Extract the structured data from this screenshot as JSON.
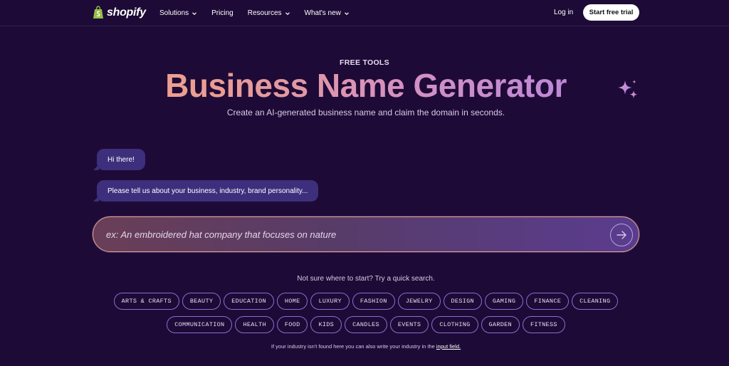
{
  "nav": {
    "logo_text": "shopify",
    "links": [
      {
        "label": "Solutions",
        "dropdown": true
      },
      {
        "label": "Pricing",
        "dropdown": false
      },
      {
        "label": "Resources",
        "dropdown": true
      },
      {
        "label": "What's new",
        "dropdown": true
      }
    ],
    "login_label": "Log in",
    "cta_label": "Start free trial"
  },
  "hero": {
    "eyebrow": "FREE TOOLS",
    "title": "Business Name Generator",
    "subtitle": "Create an AI-generated business name and claim the domain in seconds."
  },
  "chat": {
    "messages": [
      "Hi there!",
      "Please tell us about your business, industry, brand personality..."
    ]
  },
  "prompt": {
    "placeholder": "ex: An embroidered hat company that focuses on nature",
    "value": ""
  },
  "quick_search": {
    "hint": "Not sure where to start? Try a quick search.",
    "row1": [
      "ARTS & CRAFTS",
      "BEAUTY",
      "EDUCATION",
      "HOME",
      "LUXURY",
      "FASHION",
      "JEWELRY",
      "DESIGN",
      "GAMING",
      "FINANCE",
      "CLEANING"
    ],
    "row2": [
      "COMMUNICATION",
      "HEALTH",
      "FOOD",
      "KIDS",
      "CANDLES",
      "EVENTS",
      "CLOTHING",
      "GARDEN",
      "FITNESS"
    ]
  },
  "footnote": {
    "text": "If your industry isn't found here you can also write your industry in the",
    "link": "input field."
  },
  "colors": {
    "background": "#1e0a36",
    "bubble": "#3e2f7d",
    "chip_border": "#8a6fd1",
    "title_gradient": [
      "#f3a98a",
      "#cf8fc8",
      "#a57ee8"
    ]
  }
}
